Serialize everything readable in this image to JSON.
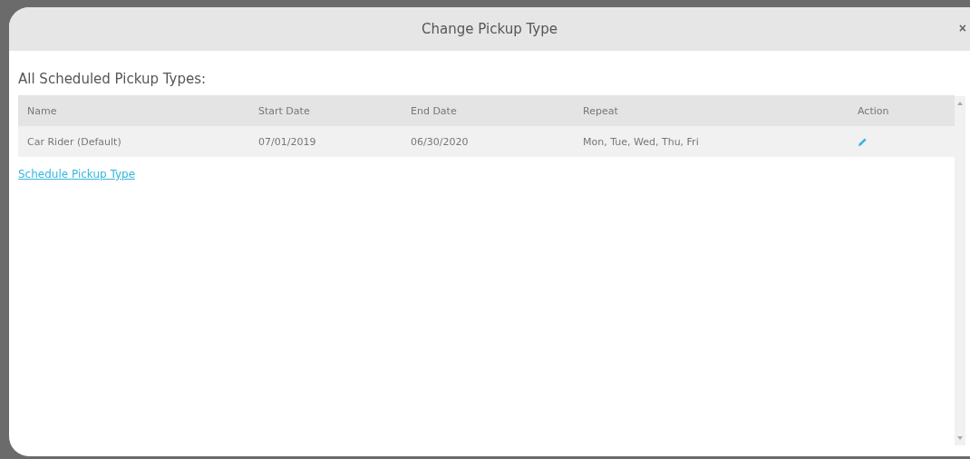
{
  "dialog": {
    "title": "Change Pickup Type",
    "close": "×"
  },
  "section_title": "All Scheduled Pickup Types:",
  "table": {
    "columns": [
      "Name",
      "Start Date",
      "End Date",
      "Repeat",
      "Action"
    ],
    "rows": [
      {
        "name": "Car Rider (Default)",
        "start_date": "07/01/2019",
        "end_date": "06/30/2020",
        "repeat": "Mon, Tue, Wed, Thu, Fri"
      }
    ]
  },
  "link": "Schedule Pickup Type"
}
